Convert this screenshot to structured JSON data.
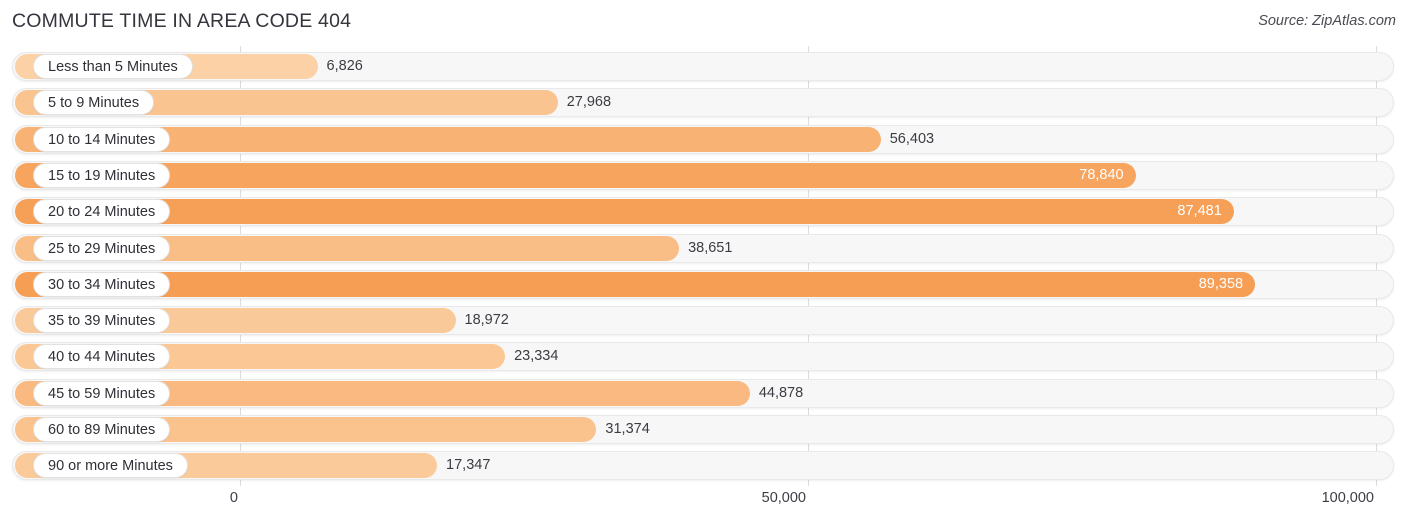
{
  "header": {
    "title": "COMMUTE TIME IN AREA CODE 404",
    "source": "Source: ZipAtlas.com"
  },
  "axis": {
    "ticks": [
      {
        "label": "0",
        "value": 0
      },
      {
        "label": "50,000",
        "value": 50000
      },
      {
        "label": "100,000",
        "value": 100000
      }
    ]
  },
  "colors": {
    "bar_light": "#FBCFA3",
    "bar_dark": "#F6A25A",
    "track": "#F7F7F7",
    "track_border": "#E9E9E9",
    "gridline": "#DCDCDC",
    "text": "#3C3C44",
    "value_inside": "#FFFFFF"
  },
  "chart_data": {
    "type": "bar",
    "orientation": "horizontal",
    "title": "COMMUTE TIME IN AREA CODE 404",
    "subtitle": "",
    "xlabel": "",
    "ylabel": "",
    "xlim": [
      0,
      100000
    ],
    "grid": true,
    "legend": false,
    "source": "Source: ZipAtlas.com",
    "categories": [
      "Less than 5 Minutes",
      "5 to 9 Minutes",
      "10 to 14 Minutes",
      "15 to 19 Minutes",
      "20 to 24 Minutes",
      "25 to 29 Minutes",
      "30 to 34 Minutes",
      "35 to 39 Minutes",
      "40 to 44 Minutes",
      "45 to 59 Minutes",
      "60 to 89 Minutes",
      "90 or more Minutes"
    ],
    "values": [
      6826,
      27968,
      56403,
      78840,
      87481,
      38651,
      89358,
      18972,
      23334,
      44878,
      31374,
      17347
    ],
    "value_labels": [
      "6,826",
      "27,968",
      "56,403",
      "78,840",
      "87,481",
      "38,651",
      "89,358",
      "18,972",
      "23,334",
      "44,878",
      "31,374",
      "17,347"
    ]
  },
  "rows": [
    {
      "label": "Less than 5 Minutes",
      "value": 6826,
      "value_label": "6,826",
      "label_inside": false
    },
    {
      "label": "5 to 9 Minutes",
      "value": 27968,
      "value_label": "27,968",
      "label_inside": false
    },
    {
      "label": "10 to 14 Minutes",
      "value": 56403,
      "value_label": "56,403",
      "label_inside": false
    },
    {
      "label": "15 to 19 Minutes",
      "value": 78840,
      "value_label": "78,840",
      "label_inside": true
    },
    {
      "label": "20 to 24 Minutes",
      "value": 87481,
      "value_label": "87,481",
      "label_inside": true
    },
    {
      "label": "25 to 29 Minutes",
      "value": 38651,
      "value_label": "38,651",
      "label_inside": false
    },
    {
      "label": "30 to 34 Minutes",
      "value": 89358,
      "value_label": "89,358",
      "label_inside": true
    },
    {
      "label": "35 to 39 Minutes",
      "value": 18972,
      "value_label": "18,972",
      "label_inside": false
    },
    {
      "label": "40 to 44 Minutes",
      "value": 23334,
      "value_label": "23,334",
      "label_inside": false
    },
    {
      "label": "45 to 59 Minutes",
      "value": 44878,
      "value_label": "44,878",
      "label_inside": false
    },
    {
      "label": "60 to 89 Minutes",
      "value": 31374,
      "value_label": "31,374",
      "label_inside": false
    },
    {
      "label": "90 or more Minutes",
      "value": 17347,
      "value_label": "17,347",
      "label_inside": false
    }
  ]
}
